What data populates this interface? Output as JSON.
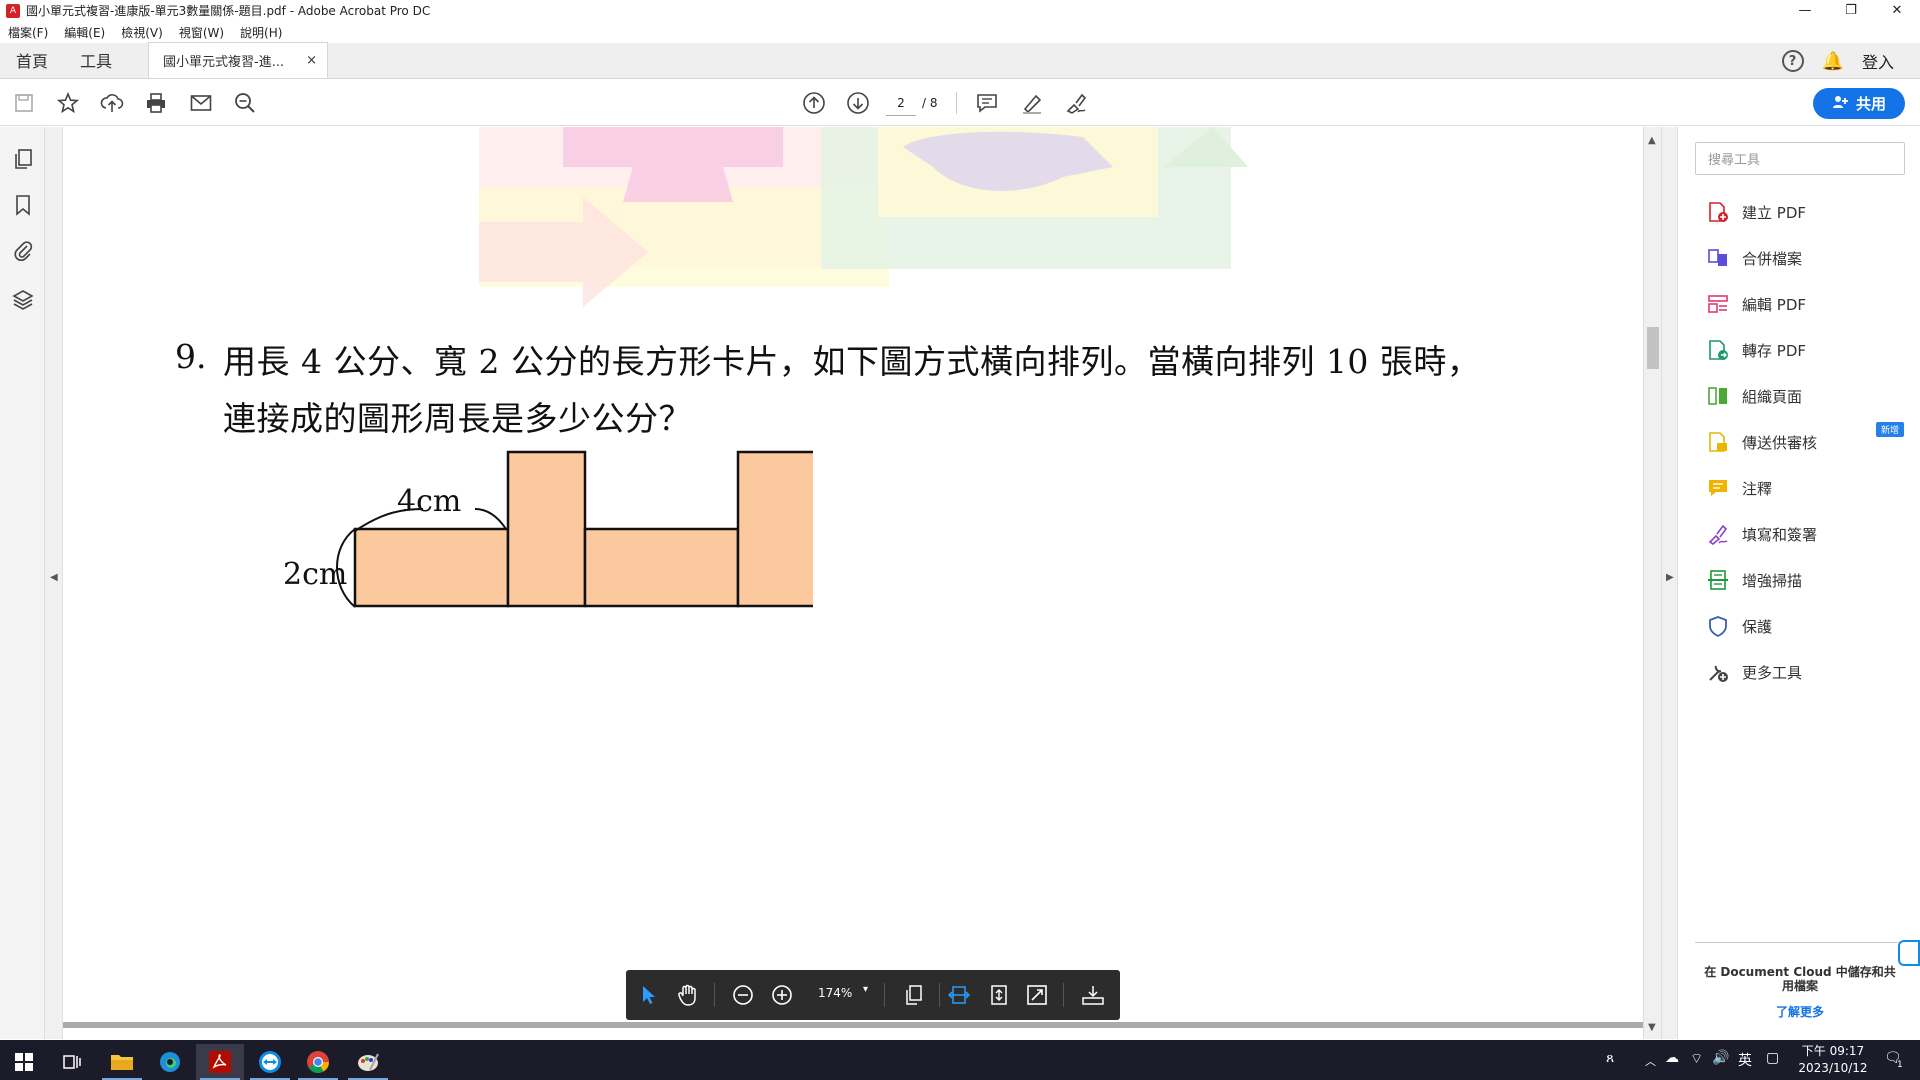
{
  "window": {
    "title": "國小單元式複習-進康版-單元3數量關係-題目.pdf - Adobe Acrobat Pro DC",
    "min": "—",
    "max": "❐",
    "close": "✕"
  },
  "menu": [
    "檔案(F)",
    "編輯(E)",
    "檢視(V)",
    "視窗(W)",
    "說明(H)"
  ],
  "tabs": {
    "home": "首頁",
    "tools": "工具",
    "doc": "國小單元式複習-進...",
    "close": "×",
    "help": "?",
    "login": "登入"
  },
  "toolbar": {
    "page_current": "2",
    "page_total": "/ 8",
    "share_label": "共用"
  },
  "document": {
    "q_number": "9.",
    "q_line1": "用長 4 公分、寬 2 公分的長方形卡片，如下圖方式橫向排列。當橫向排列 10 張時，",
    "q_line2": "連接成的圖形周長是多少公分？",
    "label_length": "4cm",
    "label_width": "2cm"
  },
  "floatbar": {
    "zoom": "174%",
    "dropdown": "▾"
  },
  "right_panel": {
    "search_placeholder": "搜尋工具",
    "tools": [
      {
        "label": "建立 PDF",
        "icon": "create-pdf-icon",
        "color": "#d2232a"
      },
      {
        "label": "合併檔案",
        "icon": "combine-files-icon",
        "color": "#5b4dd8"
      },
      {
        "label": "編輯 PDF",
        "icon": "edit-pdf-icon",
        "color": "#e03a6e"
      },
      {
        "label": "轉存 PDF",
        "icon": "export-pdf-icon",
        "color": "#1a9b6a"
      },
      {
        "label": "組織頁面",
        "icon": "organize-pages-icon",
        "color": "#4aa834"
      },
      {
        "label": "傳送供審核",
        "icon": "send-review-icon",
        "color": "#e6b800"
      },
      {
        "label": "注釋",
        "icon": "comment-icon",
        "color": "#f0b400"
      },
      {
        "label": "填寫和簽署",
        "icon": "fill-sign-icon",
        "color": "#8a3fd1"
      },
      {
        "label": "增強掃描",
        "icon": "enhance-scan-icon",
        "color": "#1a9b3a"
      },
      {
        "label": "保護",
        "icon": "protect-icon",
        "color": "#3a5fb0"
      },
      {
        "label": "更多工具",
        "icon": "more-tools-icon",
        "color": "#444444"
      }
    ],
    "new_badge": "新增",
    "cloud_text": "在 Document Cloud 中儲存和共用檔案",
    "learn_more": "了解更多"
  },
  "taskbar": {
    "time": "下午 09:17",
    "date": "2023/10/12",
    "lang": "英",
    "notif_count": "1"
  }
}
